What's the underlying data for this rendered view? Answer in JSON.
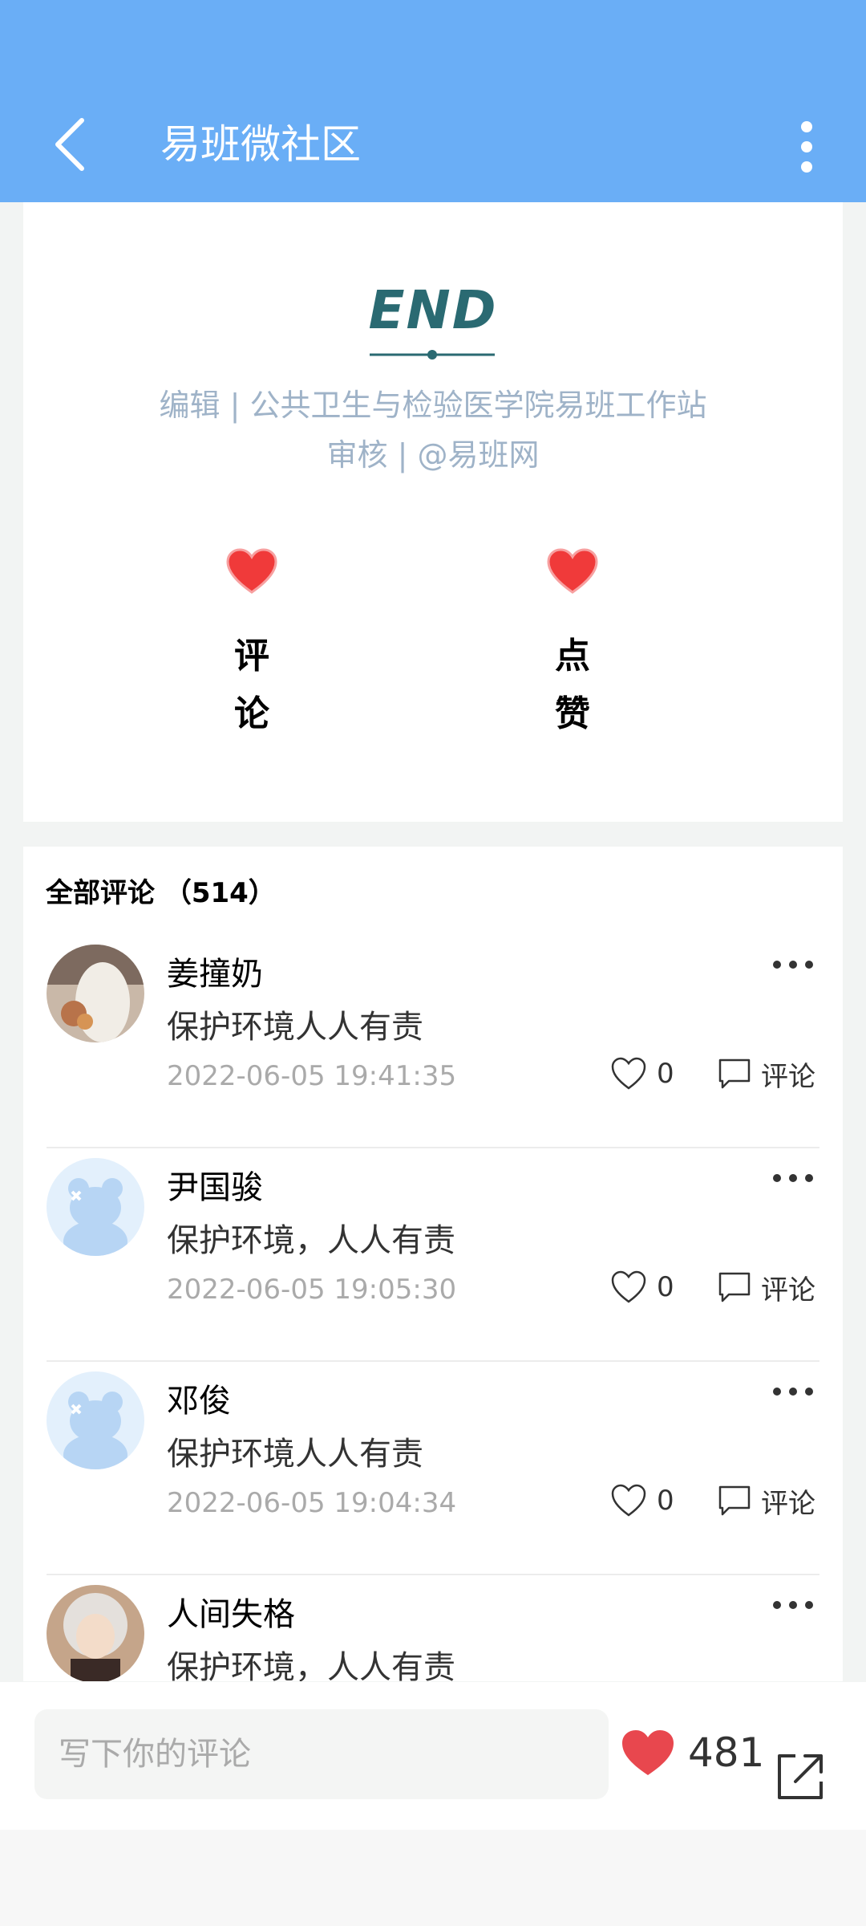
{
  "header": {
    "title": "易班微社区"
  },
  "article": {
    "end_title": "END",
    "credit_editor": "编辑 | 公共卫生与检验医学院易班工作站",
    "credit_review": "审核 | @易班网",
    "actions": [
      {
        "label_line1": "评",
        "label_line2": "论"
      },
      {
        "label_line1": "点",
        "label_line2": "赞"
      }
    ]
  },
  "comments": {
    "header": "全部评论 （514）",
    "items": [
      {
        "name": "姜撞奶",
        "text": "保护环境人人有责",
        "date": "2022-06-05 19:41:35",
        "likes": "0",
        "reply_label": "评论",
        "avatar": "photo"
      },
      {
        "name": "尹国骏",
        "text": "保护环境，人人有责",
        "date": "2022-06-05 19:05:30",
        "likes": "0",
        "reply_label": "评论",
        "avatar": "default-bear"
      },
      {
        "name": "邓俊",
        "text": "保护环境人人有责",
        "date": "2022-06-05 19:04:34",
        "likes": "0",
        "reply_label": "评论",
        "avatar": "default-bear"
      },
      {
        "name": "人间失格",
        "text": "保护环境，人人有责",
        "date": "",
        "likes": "",
        "reply_label": "",
        "avatar": "photo-anime"
      }
    ]
  },
  "bottom_bar": {
    "input_placeholder": "写下你的评论",
    "like_count": "481"
  },
  "colors": {
    "header_bg": "#6aaef6",
    "heart_red": "#e8474e",
    "end_teal": "#2a6a72"
  }
}
